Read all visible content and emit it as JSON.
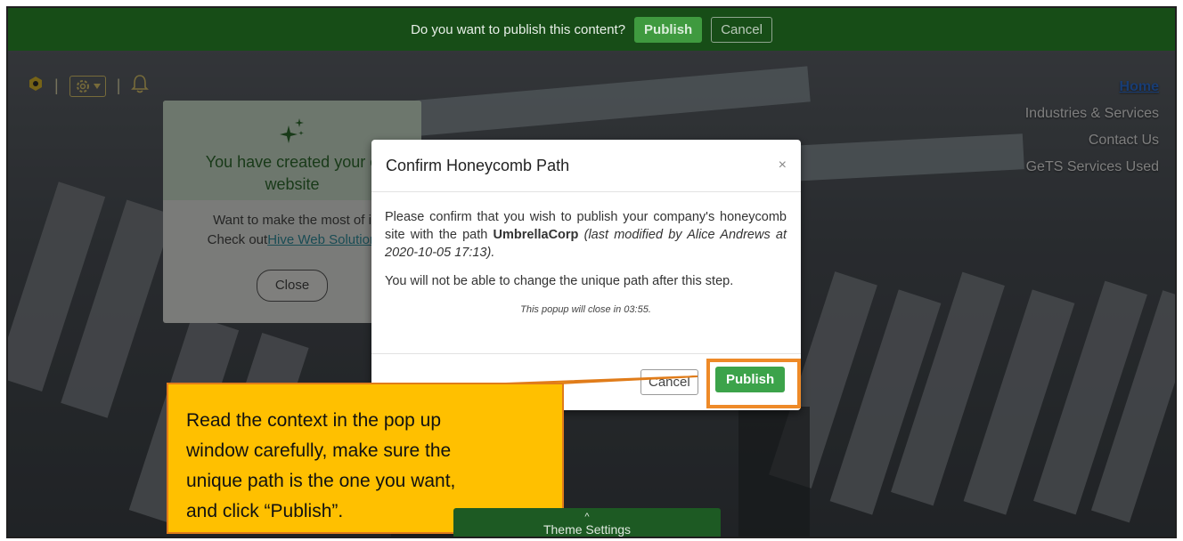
{
  "publish_bar": {
    "question": "Do you want to publish this content?",
    "publish_label": "Publish",
    "cancel_label": "Cancel"
  },
  "nav": {
    "items": [
      {
        "label": "Home",
        "active": true
      },
      {
        "label": "Industries & Services"
      },
      {
        "label": "Contact Us"
      },
      {
        "label": "GeTS Services Used"
      }
    ]
  },
  "notice": {
    "title_line1": "You have created your o",
    "title_line2": "website",
    "body_line1": "Want to make the most of i",
    "body_prefix": "Check out",
    "body_link": "Hive Web Solution",
    "close_label": "Close"
  },
  "modal": {
    "title": "Confirm Honeycomb Path",
    "close_glyph": "×",
    "para1_prefix": "Please confirm that you wish to publish your company's honeycomb site with the path ",
    "path_name": "UmbrellaCorp",
    "para1_meta": "(last modified by Alice Andrews at 2020-10-05 17:13).",
    "para2": "You will not be able to change the unique path after this step.",
    "timer": "This popup will close in 03:55.",
    "cancel_label": "Cancel",
    "publish_label": "Publish"
  },
  "callout": {
    "line1": "Read the context in the pop up",
    "line2": "window carefully, make sure the",
    "line3": "unique path is the one you want,",
    "line4": "and click “Publish”."
  },
  "theme_tab": {
    "chevron": "^",
    "label": "Theme Settings"
  },
  "colors": {
    "publish_bar_bg": "#174d17",
    "accent_green": "#3ca34a",
    "callout_fill": "#ffc000",
    "highlight_orange": "#ee8a28"
  }
}
